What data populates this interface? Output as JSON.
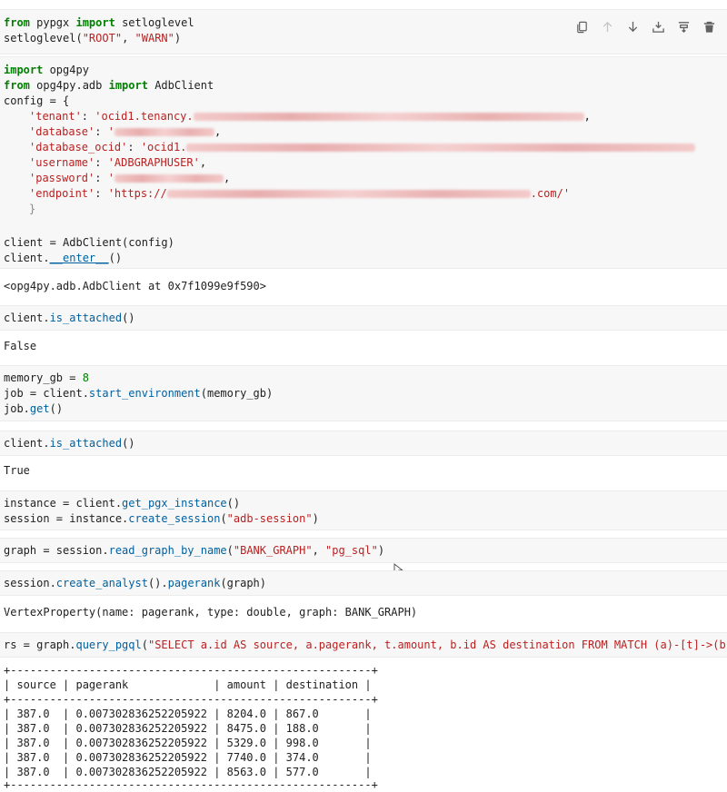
{
  "toolbar": {
    "icons": [
      "copy-icon",
      "arrow-up-icon",
      "arrow-down-icon",
      "insert-below-icon",
      "merge-icon",
      "delete-icon"
    ]
  },
  "colors": {
    "keyword": "#008000",
    "string": "#ba2121",
    "function": "#0060a0",
    "cell_bg": "#f7f7f7"
  },
  "cell1": {
    "kw_from": "from",
    "mod": " pypgx ",
    "kw_import": "import",
    "name": " setloglevel",
    "call": "setloglevel(",
    "arg1": "\"ROOT\"",
    "sep": ", ",
    "arg2": "\"WARN\"",
    "close": ")"
  },
  "cell2": {
    "l1_kw": "import",
    "l1_rest": " opg4py",
    "l2_kw": "from",
    "l2_mod": " opg4py.adb ",
    "l2_kw2": "import",
    "l2_rest": " AdbClient",
    "l3": "config = {",
    "tenant_key": "'tenant'",
    "tenant_val_prefix": "'ocid1.tenancy.",
    "database_key": "'database'",
    "database_val_prefix": "'",
    "database_ocid_key": "'database_ocid'",
    "database_ocid_val_prefix": "'ocid1.",
    "username_key": "'username'",
    "username_val": "'ADBGRAPHUSER'",
    "password_key": "'password'",
    "password_val_prefix": "'",
    "endpoint_key": "'endpoint'",
    "endpoint_val_prefix": "'https://",
    "endpoint_val_suffix": ".com/'",
    "close": "}",
    "client_line": "client = AdbClient(config)",
    "enter_prefix": "client.",
    "enter_fn": "__enter__",
    "enter_suffix": "()"
  },
  "out2": "<opg4py.adb.AdbClient at 0x7f1099e9f590>",
  "cell3": {
    "obj": "client.",
    "fn": "is_attached",
    "rest": "()"
  },
  "out3": "False",
  "cell4": {
    "l1_a": "memory_gb = ",
    "l1_num": "8",
    "l2_a": "job = client.",
    "l2_fn": "start_environment",
    "l2_b": "(memory_gb)",
    "l3_a": "job.",
    "l3_fn": "get",
    "l3_b": "()"
  },
  "cell5": {
    "obj": "client.",
    "fn": "is_attached",
    "rest": "()"
  },
  "out5": "True",
  "cell6": {
    "l1_a": "instance = client.",
    "l1_fn": "get_pgx_instance",
    "l1_b": "()",
    "l2_a": "session = instance.",
    "l2_fn": "create_session",
    "l2_b": "(",
    "l2_str": "\"adb-session\"",
    "l2_c": ")"
  },
  "cell7": {
    "a": "graph = session.",
    "fn": "read_graph_by_name",
    "b": "(",
    "s1": "\"BANK_GRAPH\"",
    "c": ", ",
    "s2": "\"pg_sql\"",
    "d": ")"
  },
  "cell8": {
    "a": "session.",
    "fn1": "create_analyst",
    "b": "().",
    "fn2": "pagerank",
    "c": "(graph)"
  },
  "out8": "VertexProperty(name: pagerank, type: double, graph: BANK_GRAPH)",
  "cell9": {
    "a": "rs = graph.",
    "fn": "query_pgql",
    "b": "(",
    "str": "\"SELECT a.id AS source, a.pagerank, t.amount, b.id AS destination FROM MATCH (a)-[t]->(b) ORDER"
  },
  "table": {
    "border": "+-------------------------------------------------------+",
    "header": "| source | pagerank             | amount | destination |",
    "rows": [
      "| 387.0  | 0.007302836252205922 | 8204.0 | 867.0       |",
      "| 387.0  | 0.007302836252205922 | 8475.0 | 188.0       |",
      "| 387.0  | 0.007302836252205922 | 5329.0 | 998.0       |",
      "| 387.0  | 0.007302836252205922 | 7740.0 | 374.0       |",
      "| 387.0  | 0.007302836252205922 | 8563.0 | 577.0       |"
    ]
  }
}
